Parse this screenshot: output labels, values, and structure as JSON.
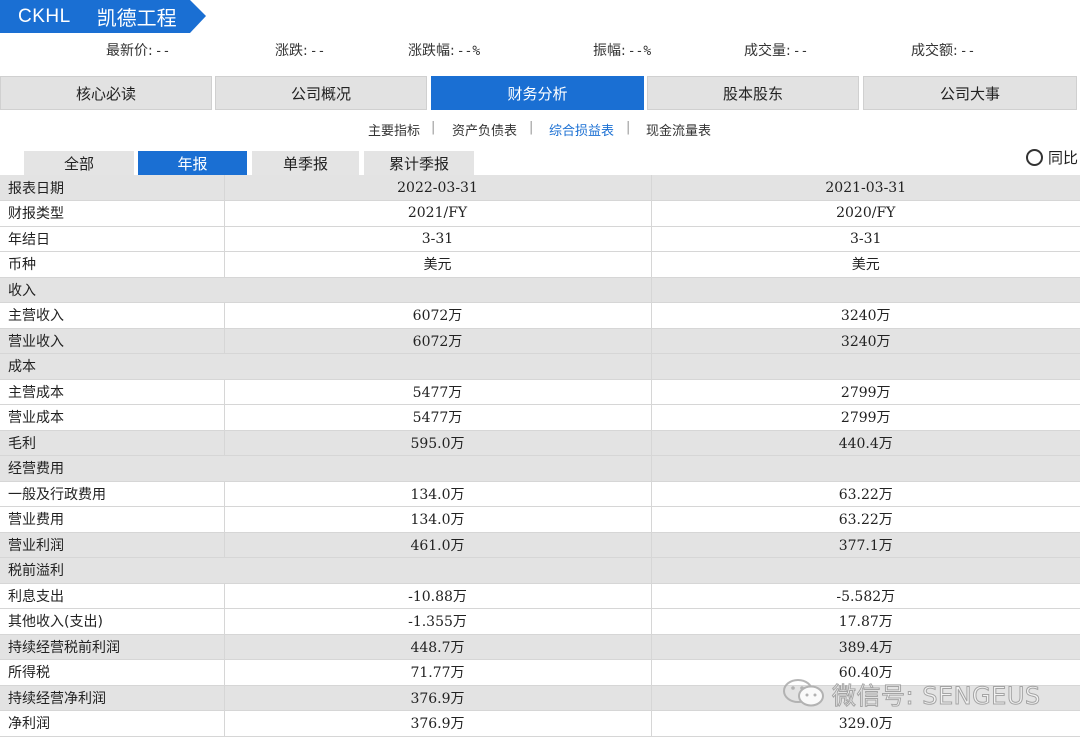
{
  "header": {
    "code": "CKHL",
    "name": "凯德工程"
  },
  "quote": [
    {
      "label": "最新价:",
      "value": "--"
    },
    {
      "label": "涨跌:",
      "value": "--"
    },
    {
      "label": "涨跌幅:",
      "value": "--%"
    },
    {
      "label": "振幅:",
      "value": "--%"
    },
    {
      "label": "成交量:",
      "value": "--"
    },
    {
      "label": "成交额:",
      "value": "--"
    }
  ],
  "main_tabs": [
    "核心必读",
    "公司概况",
    "财务分析",
    "股本股东",
    "公司大事"
  ],
  "main_tab_active": "财务分析",
  "subnav": [
    "主要指标",
    "资产负债表",
    "综合损益表",
    "现金流量表"
  ],
  "subnav_active": "综合损益表",
  "period_tabs": [
    "全部",
    "年报",
    "单季报",
    "累计季报"
  ],
  "period_active": "年报",
  "yoy_label": "同比",
  "table": {
    "header": {
      "label": "报表日期",
      "col1": "2022-03-31",
      "col2": "2021-03-31"
    },
    "rows": [
      {
        "label": "财报类型",
        "col1": "2021/FY",
        "col2": "2020/FY",
        "style": "plain"
      },
      {
        "label": "年结日",
        "col1": "3-31",
        "col2": "3-31",
        "style": "plain"
      },
      {
        "label": "币种",
        "col1": "美元",
        "col2": "美元",
        "style": "plain"
      },
      {
        "label": "收入",
        "col1": "",
        "col2": "",
        "style": "section"
      },
      {
        "label": "主营收入",
        "col1": "6072万",
        "col2": "3240万",
        "style": "plain"
      },
      {
        "label": "营业收入",
        "col1": "6072万",
        "col2": "3240万",
        "style": "gray"
      },
      {
        "label": "成本",
        "col1": "",
        "col2": "",
        "style": "section"
      },
      {
        "label": "主营成本",
        "col1": "5477万",
        "col2": "2799万",
        "style": "plain"
      },
      {
        "label": "营业成本",
        "col1": "5477万",
        "col2": "2799万",
        "style": "plain"
      },
      {
        "label": "毛利",
        "col1": "595.0万",
        "col2": "440.4万",
        "style": "gray"
      },
      {
        "label": "经营费用",
        "col1": "",
        "col2": "",
        "style": "section"
      },
      {
        "label": "一般及行政费用",
        "col1": "134.0万",
        "col2": "63.22万",
        "style": "plain"
      },
      {
        "label": "营业费用",
        "col1": "134.0万",
        "col2": "63.22万",
        "style": "plain"
      },
      {
        "label": "营业利润",
        "col1": "461.0万",
        "col2": "377.1万",
        "style": "gray"
      },
      {
        "label": "税前溢利",
        "col1": "",
        "col2": "",
        "style": "section"
      },
      {
        "label": "利息支出",
        "col1": "-10.88万",
        "col2": "-5.582万",
        "style": "plain"
      },
      {
        "label": "其他收入(支出)",
        "col1": "-1.355万",
        "col2": "17.87万",
        "style": "plain"
      },
      {
        "label": "持续经营税前利润",
        "col1": "448.7万",
        "col2": "389.4万",
        "style": "gray"
      },
      {
        "label": "所得税",
        "col1": "71.77万",
        "col2": "60.40万",
        "style": "plain"
      },
      {
        "label": "持续经营净利润",
        "col1": "376.9万",
        "col2": "",
        "style": "gray"
      },
      {
        "label": "净利润",
        "col1": "376.9万",
        "col2": "329.0万",
        "style": "plain"
      }
    ]
  },
  "watermark": "微信号: SENGEUS",
  "colors": {
    "accent": "#1a6fd3",
    "tab_gray": "#e2e2e2",
    "row_gray": "#e3e3e3"
  }
}
